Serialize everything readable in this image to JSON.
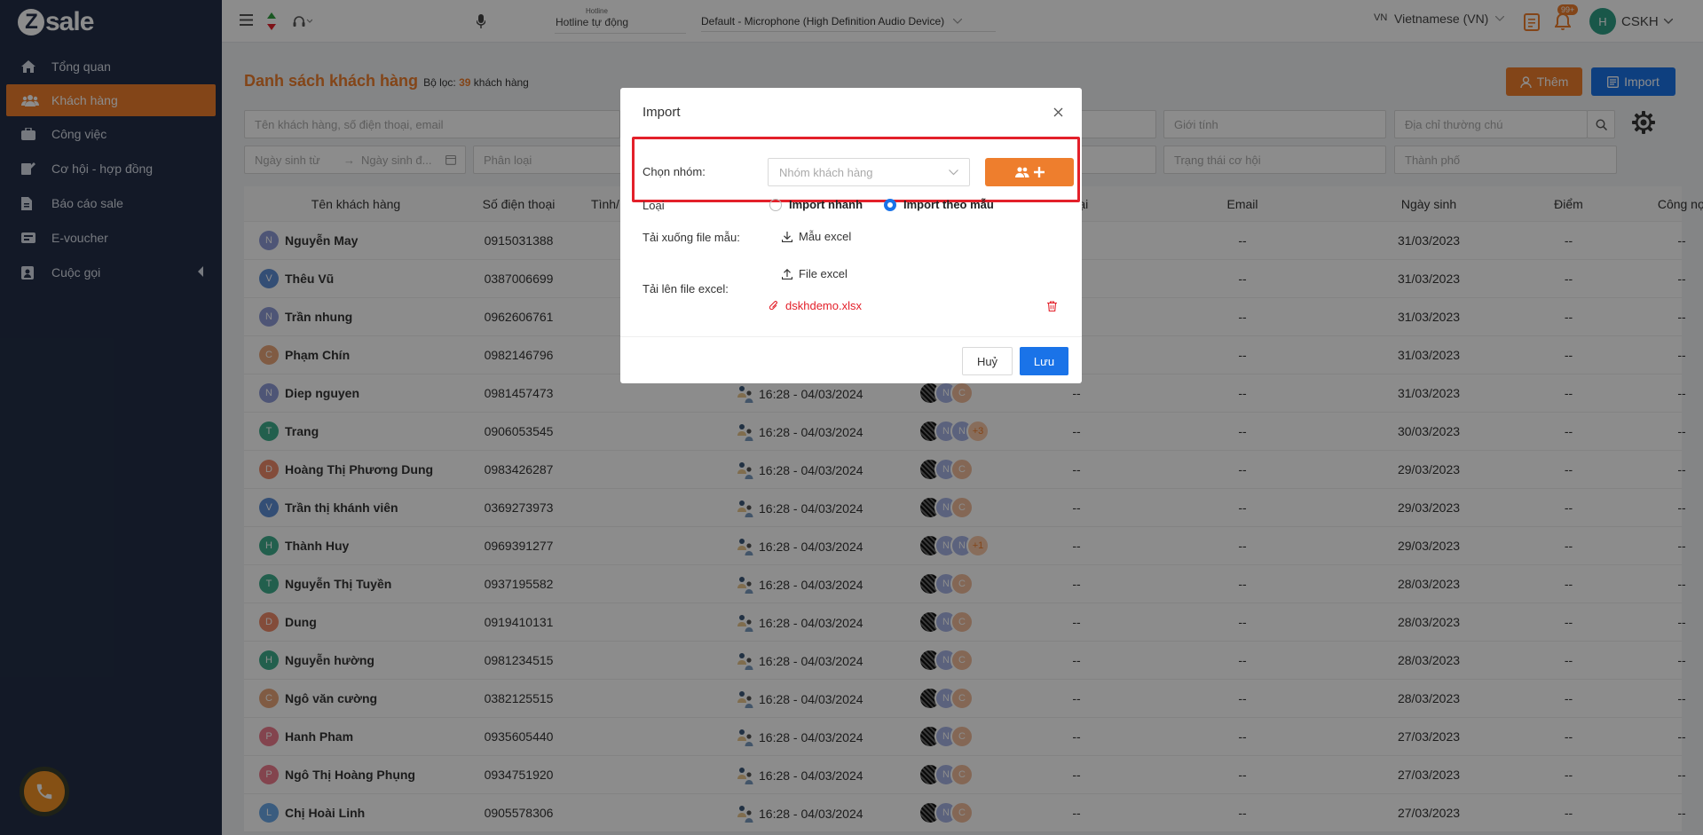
{
  "app": {
    "logo": "sale",
    "logo_mark": "Z"
  },
  "sidebar": {
    "items": [
      {
        "label": "Tổng quan",
        "icon": "home-icon"
      },
      {
        "label": "Khách hàng",
        "icon": "users-icon",
        "active": true
      },
      {
        "label": "Công việc",
        "icon": "briefcase-icon"
      },
      {
        "label": "Cơ hội - hợp đồng",
        "icon": "edit-icon"
      },
      {
        "label": "Báo cáo sale",
        "icon": "report-icon"
      },
      {
        "label": "E-voucher",
        "icon": "voucher-icon"
      },
      {
        "label": "Cuộc gọi",
        "icon": "phone-book-icon"
      }
    ]
  },
  "topbar": {
    "hotline_label": "Hotline",
    "hotline_value": "Hotline tự động",
    "mic_value": "Default - Microphone (High Definition Audio Device)",
    "lang_code": "VN",
    "lang_label": "Vietnamese (VN)",
    "notif_badge": "99+",
    "user_initial": "H",
    "user_name": "CSKH"
  },
  "page": {
    "title": "Danh sách khách hàng",
    "filter_prefix": "Bộ lọc:",
    "filter_count": "39",
    "filter_suffix": "khách hàng",
    "btn_add": "Thêm",
    "btn_import": "Import"
  },
  "filters": {
    "search": "Tên khách hàng, số điện thoại, email",
    "gender": "Giới tính",
    "address": "Địa chỉ thường chú",
    "dob_from": "Ngày sinh từ",
    "dob_to": "Ngày sinh đ...",
    "category": "Phân loại",
    "opp_status": "Trạng thái cơ hội",
    "city": "Thành phố"
  },
  "table": {
    "headers": [
      "Tên khách hàng",
      "Số điện thoại",
      "Tình/",
      "Loại",
      "Email",
      "Ngày sinh",
      "Điểm",
      "Công nợ"
    ],
    "rows": [
      {
        "initial": "N",
        "color": "#8e9bd8",
        "name": "Nguyễn May",
        "phone": "0915031388",
        "time": "",
        "dob": "31/03/2023",
        "extra": ""
      },
      {
        "initial": "V",
        "color": "#5e8fd6",
        "name": "Thêu Vũ",
        "phone": "0387006699",
        "time": "",
        "dob": "31/03/2023",
        "extra": ""
      },
      {
        "initial": "N",
        "color": "#8e9bd8",
        "name": "Trần nhung",
        "phone": "0962606761",
        "time": "",
        "dob": "31/03/2023",
        "extra": ""
      },
      {
        "initial": "C",
        "color": "#e9a77a",
        "name": "Phạm Chín",
        "phone": "0982146796",
        "time": "",
        "dob": "31/03/2023",
        "extra": ""
      },
      {
        "initial": "N",
        "color": "#8e9bd8",
        "name": "Diep nguyen",
        "phone": "0981457473",
        "time": "16:28 - 04/03/2024",
        "dob": "31/03/2023",
        "extra": ""
      },
      {
        "initial": "T",
        "color": "#3fae8c",
        "name": "Trang",
        "phone": "0906053545",
        "time": "16:28 - 04/03/2024",
        "dob": "30/03/2023",
        "extra": "+3"
      },
      {
        "initial": "D",
        "color": "#ef8a6a",
        "name": "Hoàng Thị Phương Dung",
        "phone": "0983426287",
        "time": "16:28 - 04/03/2024",
        "dob": "29/03/2023",
        "extra": ""
      },
      {
        "initial": "V",
        "color": "#5e8fd6",
        "name": "Trần thị khánh viên",
        "phone": "0369273973",
        "time": "16:28 - 04/03/2024",
        "dob": "29/03/2023",
        "extra": ""
      },
      {
        "initial": "H",
        "color": "#3fae8c",
        "name": "Thành Huy",
        "phone": "0969391277",
        "time": "16:28 - 04/03/2024",
        "dob": "29/03/2023",
        "extra": "+1"
      },
      {
        "initial": "T",
        "color": "#3fae8c",
        "name": "Nguyễn Thị Tuyền",
        "phone": "0937195582",
        "time": "16:28 - 04/03/2024",
        "dob": "28/03/2023",
        "extra": ""
      },
      {
        "initial": "D",
        "color": "#ef8a6a",
        "name": "Dung",
        "phone": "0919410131",
        "time": "16:28 - 04/03/2024",
        "dob": "28/03/2023",
        "extra": ""
      },
      {
        "initial": "H",
        "color": "#3fae8c",
        "name": "Nguyễn hường",
        "phone": "0981234515",
        "time": "16:28 - 04/03/2024",
        "dob": "28/03/2023",
        "extra": ""
      },
      {
        "initial": "C",
        "color": "#e9a77a",
        "name": "Ngô văn cường",
        "phone": "0382125515",
        "time": "16:28 - 04/03/2024",
        "dob": "28/03/2023",
        "extra": ""
      },
      {
        "initial": "P",
        "color": "#ef7c8e",
        "name": "Hanh Pham",
        "phone": "0935605440",
        "time": "16:28 - 04/03/2024",
        "dob": "27/03/2023",
        "extra": ""
      },
      {
        "initial": "P",
        "color": "#ef7c8e",
        "name": "Ngô Thị Hoàng Phụng",
        "phone": "0934751920",
        "time": "16:28 - 04/03/2024",
        "dob": "27/03/2023",
        "extra": ""
      },
      {
        "initial": "L",
        "color": "#6aa8e8",
        "name": "Chị Hoài Linh",
        "phone": "0905578306",
        "time": "16:28 - 04/03/2024",
        "dob": "27/03/2023",
        "extra": ""
      }
    ],
    "dash": "--"
  },
  "modal": {
    "title": "Import",
    "group_label": "Chọn nhóm:",
    "group_placeholder": "Nhóm khách hàng",
    "type_label": "Loại",
    "radio_quick": "Import nhanh",
    "radio_template": "Import theo mẫu",
    "download_label": "Tải xuống file mẫu:",
    "download_btn": "Mẫu excel",
    "upload_label": "Tải lên file excel:",
    "upload_btn": "File excel",
    "file_name": "dskhdemo.xlsx",
    "btn_cancel": "Huỷ",
    "btn_save": "Lưu"
  },
  "colors": {
    "brand": "#ee7e2d",
    "primary": "#1a73e8",
    "sidebar": "#232f47",
    "highlight": "#e3202a"
  }
}
